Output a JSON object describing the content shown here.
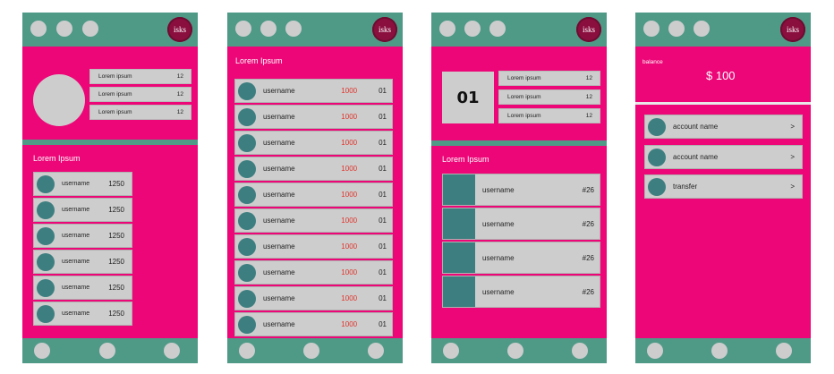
{
  "logo_text": "isks",
  "screen1": {
    "info_rows": [
      {
        "label": "Lorem ipsum",
        "value": "12"
      },
      {
        "label": "Lorem ipsum",
        "value": "12"
      },
      {
        "label": "Lorem ipsum",
        "value": "12"
      }
    ],
    "section_title": "Lorem Ipsum",
    "list": [
      {
        "name": "username",
        "score": "1250"
      },
      {
        "name": "username",
        "score": "1250"
      },
      {
        "name": "username",
        "score": "1250"
      },
      {
        "name": "username",
        "score": "1250"
      },
      {
        "name": "username",
        "score": "1250"
      },
      {
        "name": "username",
        "score": "1250"
      }
    ]
  },
  "screen2": {
    "section_title": "Lorem Ipsum",
    "list": [
      {
        "name": "username",
        "points": "1000",
        "rank": "01"
      },
      {
        "name": "username",
        "points": "1000",
        "rank": "01"
      },
      {
        "name": "username",
        "points": "1000",
        "rank": "01"
      },
      {
        "name": "username",
        "points": "1000",
        "rank": "01"
      },
      {
        "name": "username",
        "points": "1000",
        "rank": "01"
      },
      {
        "name": "username",
        "points": "1000",
        "rank": "01"
      },
      {
        "name": "username",
        "points": "1000",
        "rank": "01"
      },
      {
        "name": "username",
        "points": "1000",
        "rank": "01"
      },
      {
        "name": "username",
        "points": "1000",
        "rank": "01"
      },
      {
        "name": "username",
        "points": "1000",
        "rank": "01"
      },
      {
        "name": "",
        "points": "",
        "rank": ""
      }
    ]
  },
  "screen3": {
    "rank_box": "01",
    "info_rows": [
      {
        "label": "Lorem ipsum",
        "value": "12"
      },
      {
        "label": "Lorem ipsum",
        "value": "12"
      },
      {
        "label": "Lorem ipsum",
        "value": "12"
      }
    ],
    "section_title": "Lorem Ipsum",
    "list": [
      {
        "name": "username",
        "tag": "#26"
      },
      {
        "name": "username",
        "tag": "#26"
      },
      {
        "name": "username",
        "tag": "#26"
      },
      {
        "name": "username",
        "tag": "#26"
      }
    ]
  },
  "screen4": {
    "balance_label": "balance",
    "balance_value": "$ 100",
    "menu": [
      {
        "label": "account name",
        "chevron": ">"
      },
      {
        "label": "account name",
        "chevron": ">"
      },
      {
        "label": "transfer",
        "chevron": ">"
      }
    ]
  }
}
